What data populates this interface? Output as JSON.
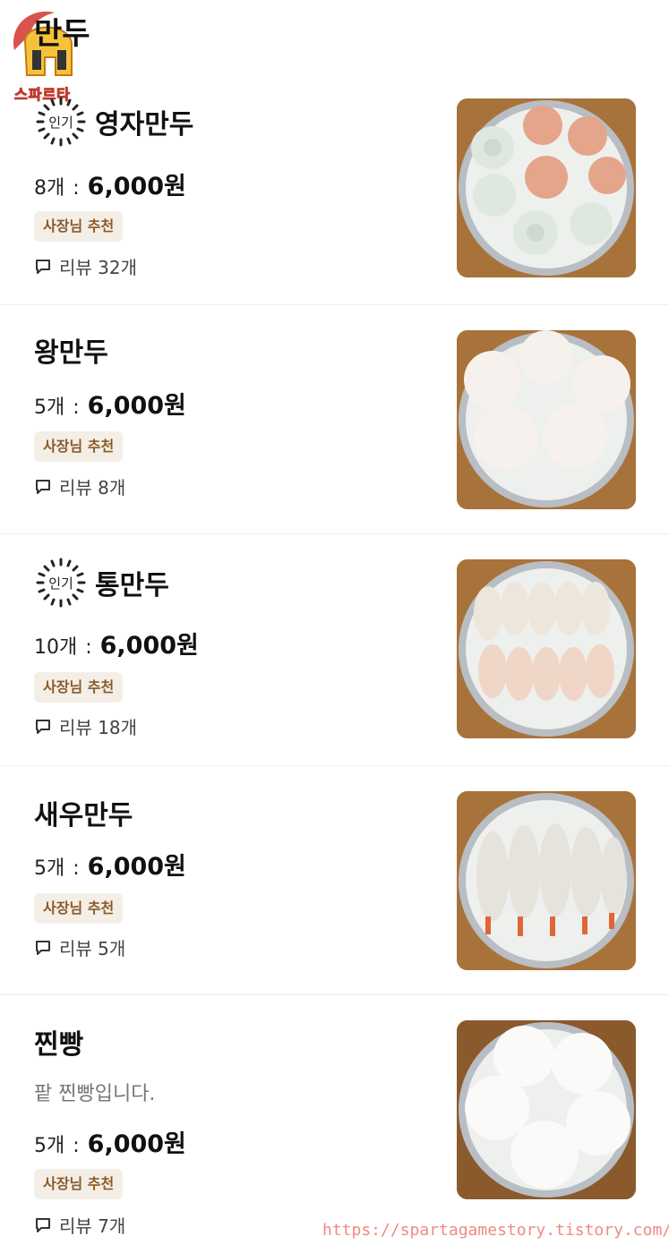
{
  "section": {
    "title": "만두",
    "logo_text": "스파르타"
  },
  "items": [
    {
      "name": "영자만두",
      "popular": true,
      "popular_label": "인기",
      "desc": "",
      "qty": "8개",
      "price": "6,000원",
      "tag": "사장님 추천",
      "review": "리뷰 32개",
      "food": "mixed dumplings on steamer"
    },
    {
      "name": "왕만두",
      "popular": false,
      "popular_label": "",
      "desc": "",
      "qty": "5개",
      "price": "6,000원",
      "tag": "사장님 추천",
      "review": "리뷰 8개",
      "food": "steamed buns on steamer"
    },
    {
      "name": "통만두",
      "popular": true,
      "popular_label": "인기",
      "desc": "",
      "qty": "10개",
      "price": "6,000원",
      "tag": "사장님 추천",
      "review": "리뷰 18개",
      "food": "pleated dumplings on steamer"
    },
    {
      "name": "새우만두",
      "popular": false,
      "popular_label": "",
      "desc": "",
      "qty": "5개",
      "price": "6,000원",
      "tag": "사장님 추천",
      "review": "리뷰 5개",
      "food": "shrimp dumplings on steamer"
    },
    {
      "name": "찐빵",
      "popular": false,
      "popular_label": "",
      "desc": "팥 찐빵입니다.",
      "qty": "5개",
      "price": "6,000원",
      "tag": "사장님 추천",
      "review": "리뷰 7개",
      "food": "white steamed buns on steamer"
    }
  ],
  "watermark": "https://spartagamestory.tistory.com/",
  "colors": {
    "tag_bg": "#f4efe6",
    "tag_text": "#8b5b2b",
    "divider": "#eeeeee",
    "watermark": "#f08a80"
  }
}
